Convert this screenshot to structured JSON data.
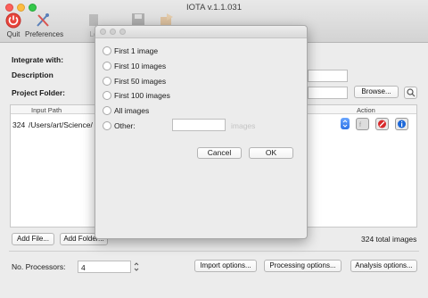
{
  "window": {
    "title": "IOTA v.1.1.031"
  },
  "toolbar": {
    "quit_label": "Quit",
    "prefs_label": "Preferences",
    "load_label": "Lo",
    "accent": "#e8453c"
  },
  "form": {
    "integrate_label": "Integrate with:",
    "description_label": "Description",
    "project_folder_label": "Project Folder:",
    "browse_label": "Browse..."
  },
  "table": {
    "headers": {
      "input_path": "Input Path",
      "action": "Action"
    },
    "rows": [
      {
        "count": "324",
        "path": "/Users/art/Science/"
      }
    ]
  },
  "bottom": {
    "add_file_label": "Add File...",
    "add_folder_label": "Add Folder...",
    "total_label": "324 total images",
    "processors_label": "No. Processors:",
    "processors_value": "4",
    "import_label": "Import options...",
    "processing_label": "Processing options...",
    "analysis_label": "Analysis options..."
  },
  "dialog": {
    "options": [
      "First 1 image",
      "First 10 images",
      "First 50 images",
      "First 100 images",
      "All images",
      "Other:"
    ],
    "other_placeholder": "",
    "other_unit": "images",
    "cancel_label": "Cancel",
    "ok_label": "OK"
  }
}
